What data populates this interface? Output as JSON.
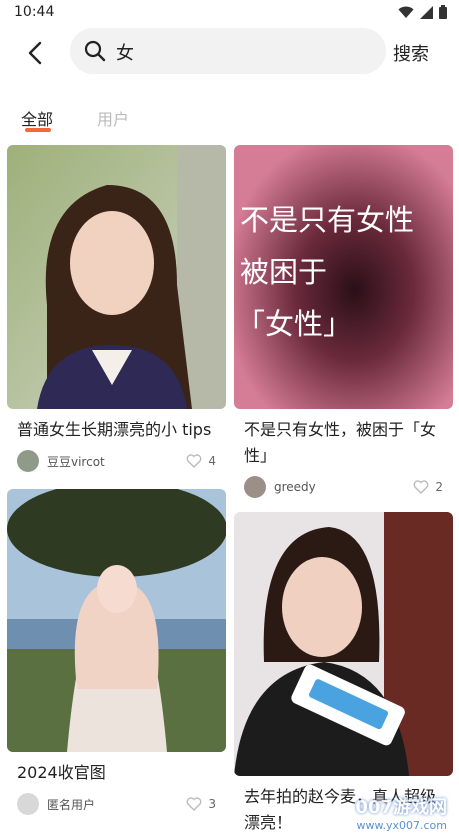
{
  "status_bar": {
    "time": "10:44"
  },
  "header": {
    "query": "女",
    "search_label": "搜索"
  },
  "tabs": [
    {
      "label": "全部"
    },
    {
      "label": "用户"
    }
  ],
  "cards": [
    {
      "title": "普通女生长期漂亮的小 tips",
      "author": "豆豆vircot",
      "likes": "4"
    },
    {
      "title": "不是只有女性，被困于「女性」",
      "author": "greedy",
      "likes": "2",
      "image_text": [
        "不是只有女性",
        "被困于",
        "「女性」"
      ]
    },
    {
      "title": "2024收官图",
      "author": "匿名用户",
      "likes": "3"
    },
    {
      "title": "去年拍的赵今麦，真人超级漂亮！",
      "author": "",
      "likes": ""
    }
  ],
  "watermark": {
    "line1": "007游戏网",
    "line2": "www.yx007.com"
  }
}
